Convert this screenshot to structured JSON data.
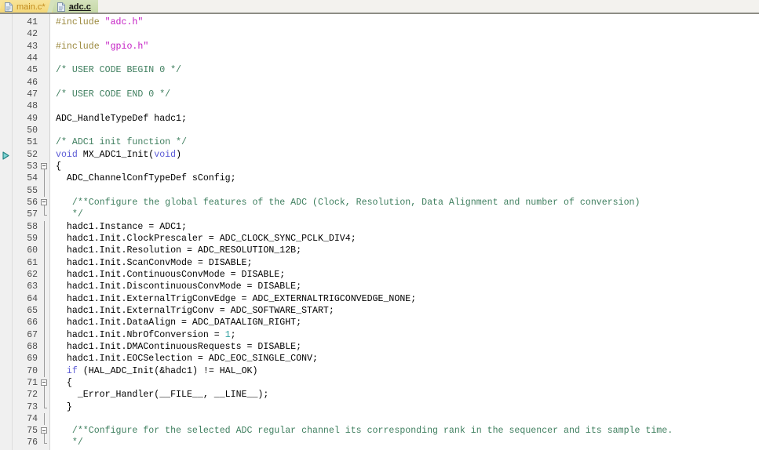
{
  "tabs": [
    {
      "label": "main.c*",
      "active": false,
      "icon": "c-file-icon"
    },
    {
      "label": "adc.c",
      "active": true,
      "icon": "c-file-icon"
    }
  ],
  "editor": {
    "first_line": 41,
    "active_file": "adc.c",
    "execution_marker_line": 52,
    "watermark": "",
    "colors": {
      "preprocessor": "#9c8a3f",
      "string": "#c41fc4",
      "comment": "#3f7f5f",
      "keyword": "#5c5cd6",
      "number": "#2a9d9d",
      "plain": "#000000",
      "gutter_bg": "#f0f0f0",
      "editor_bg": "#ffffff",
      "tab_active_bg": "#cbdcaf",
      "tab_inactive_bg": "#f6dd86"
    },
    "lines": [
      {
        "n": 41,
        "fold": "none",
        "tokens": [
          {
            "t": "#include ",
            "c": "pp"
          },
          {
            "t": "\"adc.h\"",
            "c": "str"
          }
        ]
      },
      {
        "n": 42,
        "fold": "none",
        "tokens": []
      },
      {
        "n": 43,
        "fold": "none",
        "tokens": [
          {
            "t": "#include ",
            "c": "pp"
          },
          {
            "t": "\"gpio.h\"",
            "c": "str"
          }
        ]
      },
      {
        "n": 44,
        "fold": "none",
        "tokens": []
      },
      {
        "n": 45,
        "fold": "none",
        "tokens": [
          {
            "t": "/* USER CODE BEGIN 0 */",
            "c": "cmt"
          }
        ]
      },
      {
        "n": 46,
        "fold": "none",
        "tokens": []
      },
      {
        "n": 47,
        "fold": "none",
        "tokens": [
          {
            "t": "/* USER CODE END 0 */",
            "c": "cmt"
          }
        ]
      },
      {
        "n": 48,
        "fold": "none",
        "tokens": []
      },
      {
        "n": 49,
        "fold": "none",
        "tokens": [
          {
            "t": "ADC_HandleTypeDef hadc1;",
            "c": "plain"
          }
        ]
      },
      {
        "n": 50,
        "fold": "none",
        "tokens": []
      },
      {
        "n": 51,
        "fold": "none",
        "tokens": [
          {
            "t": "/* ADC1 init function */",
            "c": "cmt"
          }
        ]
      },
      {
        "n": 52,
        "fold": "none",
        "tokens": [
          {
            "t": "void",
            "c": "kw"
          },
          {
            "t": " MX_ADC1_Init(",
            "c": "plain"
          },
          {
            "t": "void",
            "c": "kw"
          },
          {
            "t": ")",
            "c": "plain"
          }
        ]
      },
      {
        "n": 53,
        "fold": "open",
        "tokens": [
          {
            "t": "{",
            "c": "plain"
          }
        ]
      },
      {
        "n": 54,
        "fold": "bar",
        "tokens": [
          {
            "t": "  ADC_ChannelConfTypeDef sConfig;",
            "c": "plain"
          }
        ]
      },
      {
        "n": 55,
        "fold": "bar",
        "tokens": []
      },
      {
        "n": 56,
        "fold": "open",
        "tokens": [
          {
            "t": "   /**Configure the global features of the ADC (Clock, Resolution, Data Alignment and number of conversion)",
            "c": "cmt"
          }
        ]
      },
      {
        "n": 57,
        "fold": "end",
        "tokens": [
          {
            "t": "   */",
            "c": "cmt"
          }
        ]
      },
      {
        "n": 58,
        "fold": "bar",
        "tokens": [
          {
            "t": "  hadc1.Instance = ADC1;",
            "c": "plain"
          }
        ]
      },
      {
        "n": 59,
        "fold": "bar",
        "tokens": [
          {
            "t": "  hadc1.Init.ClockPrescaler = ADC_CLOCK_SYNC_PCLK_DIV4;",
            "c": "plain"
          }
        ]
      },
      {
        "n": 60,
        "fold": "bar",
        "tokens": [
          {
            "t": "  hadc1.Init.Resolution = ADC_RESOLUTION_12B;",
            "c": "plain"
          }
        ]
      },
      {
        "n": 61,
        "fold": "bar",
        "tokens": [
          {
            "t": "  hadc1.Init.ScanConvMode = DISABLE;",
            "c": "plain"
          }
        ]
      },
      {
        "n": 62,
        "fold": "bar",
        "tokens": [
          {
            "t": "  hadc1.Init.ContinuousConvMode = DISABLE;",
            "c": "plain"
          }
        ]
      },
      {
        "n": 63,
        "fold": "bar",
        "tokens": [
          {
            "t": "  hadc1.Init.DiscontinuousConvMode = DISABLE;",
            "c": "plain"
          }
        ]
      },
      {
        "n": 64,
        "fold": "bar",
        "tokens": [
          {
            "t": "  hadc1.Init.ExternalTrigConvEdge = ADC_EXTERNALTRIGCONVEDGE_NONE;",
            "c": "plain"
          }
        ]
      },
      {
        "n": 65,
        "fold": "bar",
        "tokens": [
          {
            "t": "  hadc1.Init.ExternalTrigConv = ADC_SOFTWARE_START;",
            "c": "plain"
          }
        ]
      },
      {
        "n": 66,
        "fold": "bar",
        "tokens": [
          {
            "t": "  hadc1.Init.DataAlign = ADC_DATAALIGN_RIGHT;",
            "c": "plain"
          }
        ]
      },
      {
        "n": 67,
        "fold": "bar",
        "tokens": [
          {
            "t": "  hadc1.Init.NbrOfConversion = ",
            "c": "plain"
          },
          {
            "t": "1",
            "c": "num"
          },
          {
            "t": ";",
            "c": "plain"
          }
        ]
      },
      {
        "n": 68,
        "fold": "bar",
        "tokens": [
          {
            "t": "  hadc1.Init.DMAContinuousRequests = DISABLE;",
            "c": "plain"
          }
        ]
      },
      {
        "n": 69,
        "fold": "bar",
        "tokens": [
          {
            "t": "  hadc1.Init.EOCSelection = ADC_EOC_SINGLE_CONV;",
            "c": "plain"
          }
        ]
      },
      {
        "n": 70,
        "fold": "bar",
        "tokens": [
          {
            "t": "  ",
            "c": "plain"
          },
          {
            "t": "if",
            "c": "kw"
          },
          {
            "t": " (HAL_ADC_Init(&hadc1) != HAL_OK)",
            "c": "plain"
          }
        ]
      },
      {
        "n": 71,
        "fold": "open",
        "tokens": [
          {
            "t": "  {",
            "c": "plain"
          }
        ]
      },
      {
        "n": 72,
        "fold": "bar",
        "tokens": [
          {
            "t": "    _Error_Handler(__FILE__, __LINE__);",
            "c": "plain"
          }
        ]
      },
      {
        "n": 73,
        "fold": "end",
        "tokens": [
          {
            "t": "  }",
            "c": "plain"
          }
        ]
      },
      {
        "n": 74,
        "fold": "bar",
        "tokens": []
      },
      {
        "n": 75,
        "fold": "open",
        "tokens": [
          {
            "t": "   /**Configure for the selected ADC regular channel its corresponding rank in the sequencer and its sample time.",
            "c": "cmt"
          }
        ]
      },
      {
        "n": 76,
        "fold": "end",
        "tokens": [
          {
            "t": "   */",
            "c": "cmt"
          }
        ]
      }
    ]
  }
}
